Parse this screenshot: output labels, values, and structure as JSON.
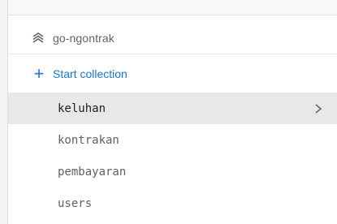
{
  "database": {
    "name": "go-ngontrak",
    "icon": "database-stack-icon"
  },
  "actions": {
    "start_collection_label": "Start collection",
    "icon": "plus-icon"
  },
  "collections": [
    {
      "name": "keluhan",
      "selected": true
    },
    {
      "name": "kontrakan",
      "selected": false
    },
    {
      "name": "pembayaran",
      "selected": false
    },
    {
      "name": "users",
      "selected": false
    }
  ],
  "colors": {
    "accent": "#1a73e8",
    "selected_bg": "#e8e8e8"
  }
}
